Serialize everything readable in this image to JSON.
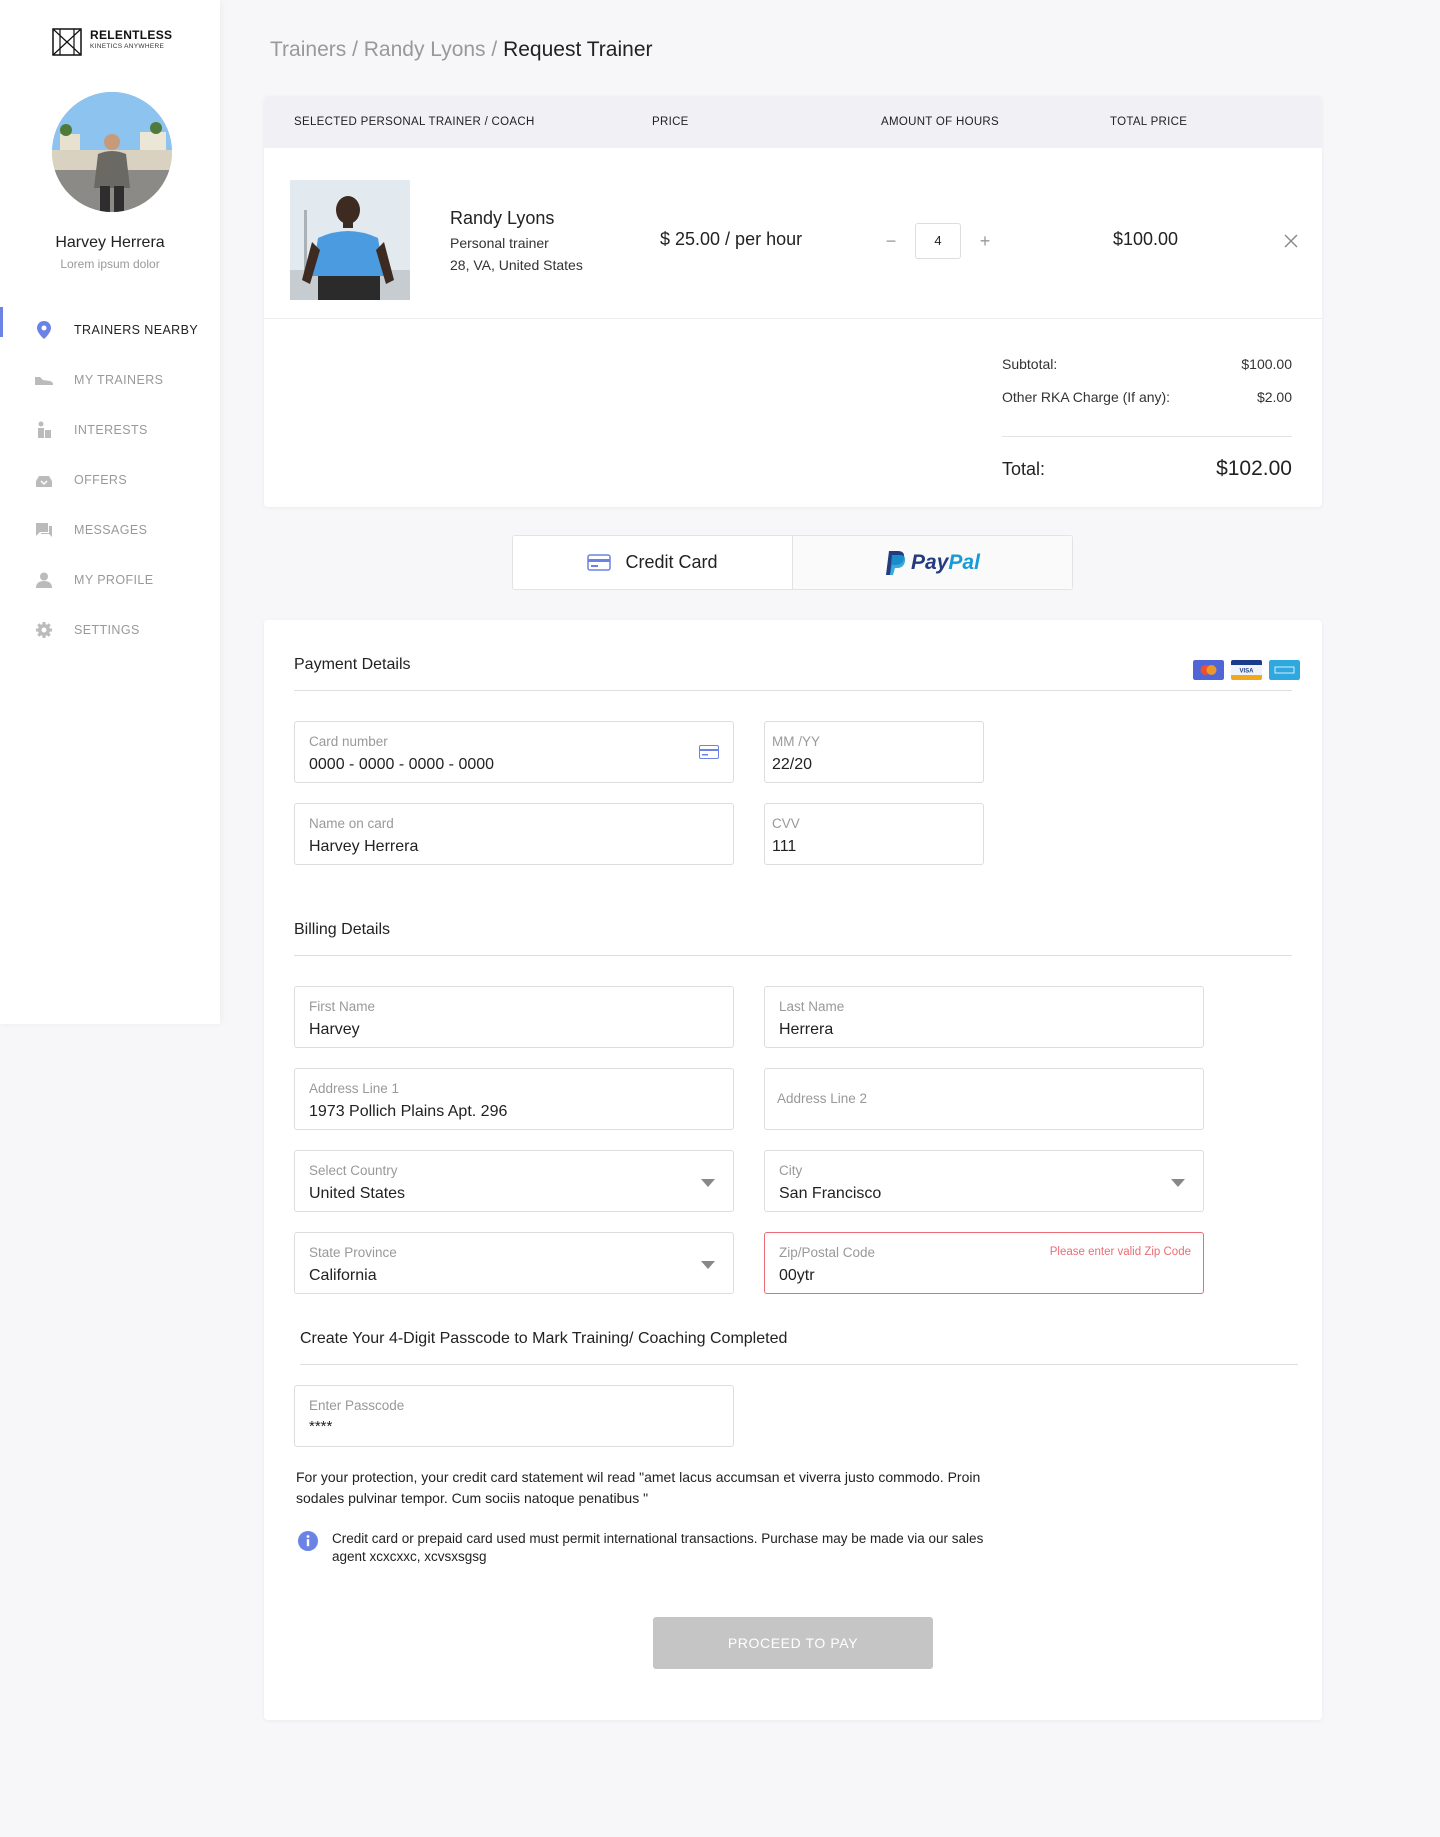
{
  "brand": {
    "name": "RELENTLESS",
    "tagline": "KINETICS ANYWHERE"
  },
  "user": {
    "name": "Harvey Herrera",
    "subtitle": "Lorem ipsum dolor"
  },
  "nav": {
    "items": [
      {
        "label": "TRAINERS NEARBY",
        "icon": "location-pin-icon",
        "active": true
      },
      {
        "label": "MY TRAINERS",
        "icon": "sneaker-icon",
        "active": false
      },
      {
        "label": "INTERESTS",
        "icon": "fitness-person-icon",
        "active": false
      },
      {
        "label": "OFFERS",
        "icon": "offers-icon",
        "active": false
      },
      {
        "label": "MESSAGES",
        "icon": "chat-icon",
        "active": false
      },
      {
        "label": "MY PROFILE",
        "icon": "person-icon",
        "active": false
      },
      {
        "label": "SETTINGS",
        "icon": "gear-icon",
        "active": false
      }
    ]
  },
  "breadcrumb": {
    "part1": "Trainers",
    "sep": " / ",
    "part2": "Randy Lyons",
    "current": "Request Trainer"
  },
  "order": {
    "headers": {
      "trainer": "SELECTED PERSONAL TRAINER / COACH",
      "price": "PRICE",
      "hours": "AMOUNT OF HOURS",
      "total": "TOTAL PRICE"
    },
    "trainer": {
      "name": "Randy Lyons",
      "role": "Personal trainer",
      "location": "28, VA, United States"
    },
    "price": "$ 25.00 / per hour",
    "quantity": "4",
    "minus": "−",
    "plus": "+",
    "total": "$100.00",
    "summary": {
      "subtotal_label": "Subtotal:",
      "subtotal_value": "$100.00",
      "charge_label": "Other RKA Charge (If any):",
      "charge_value": "$2.00",
      "total_label": "Total:",
      "total_value": "$102.00"
    }
  },
  "payment_methods": {
    "credit_card": "Credit Card",
    "paypal_pay": "Pay",
    "paypal_pal": "Pal"
  },
  "payment_details": {
    "title": "Payment Details",
    "card_number": {
      "label": "Card number",
      "value": "0000 - 0000 - 0000 - 0000"
    },
    "expiry": {
      "label": "MM /YY",
      "value": "22/20"
    },
    "name_on_card": {
      "label": "Name on card",
      "value": "Harvey Herrera"
    },
    "cvv": {
      "label": "CVV",
      "value": "111"
    }
  },
  "billing": {
    "title": "Billing Details",
    "first_name": {
      "label": "First Name",
      "value": "Harvey"
    },
    "last_name": {
      "label": "Last Name",
      "value": "Herrera"
    },
    "address1": {
      "label": "Address Line 1",
      "value": "1973 Pollich Plains Apt. 296"
    },
    "address2": {
      "label": "Address Line 2",
      "value": ""
    },
    "country": {
      "label": "Select Country",
      "value": "United States"
    },
    "city": {
      "label": "City",
      "value": "San Francisco"
    },
    "state": {
      "label": "State Province",
      "value": "California"
    },
    "zip": {
      "label": "Zip/Postal Code",
      "value": "00ytr",
      "error": "Please enter valid Zip Code"
    }
  },
  "passcode": {
    "title": "Create Your 4-Digit Passcode to Mark Training/ Coaching Completed",
    "label": "Enter Passcode",
    "value": "****"
  },
  "protection_text": "For your protection, your credit card statement wil read \"amet lacus accumsan et viverra justo commodo. Proin sodales pulvinar tempor. Cum sociis natoque penatibus \"",
  "info_text": "Credit card or prepaid card used must permit international transactions. Purchase may be made via our sales agent xcxcxxc, xcvsxsgsg",
  "proceed_label": "PROCEED TO PAY",
  "colors": {
    "accent": "#6c83e6",
    "error": "#ec6b75",
    "disabled_button": "#c5c5c5"
  }
}
